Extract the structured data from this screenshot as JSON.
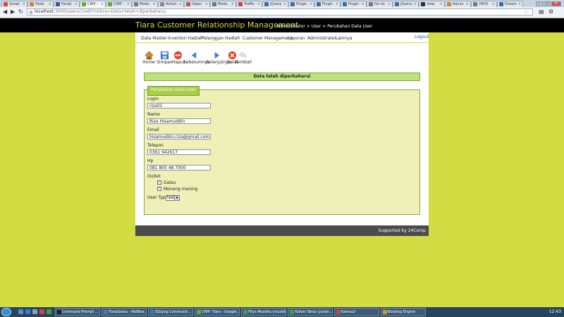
{
  "browser": {
    "tabs": [
      {
        "label": "Gmail",
        "color": "#d44"
      },
      {
        "label": "Howl",
        "color": "#c83"
      },
      {
        "label": "Faceb",
        "color": "#3b5998"
      },
      {
        "label": "CRM -",
        "color": "#6a3",
        "active": true
      },
      {
        "label": "CRM -",
        "color": "#6a3"
      },
      {
        "label": "Modu",
        "color": "#777"
      },
      {
        "label": "Action",
        "color": "#888"
      },
      {
        "label": "Oops!",
        "color": "#b55"
      },
      {
        "label": "Modu",
        "color": "#777"
      },
      {
        "label": "Traffic",
        "color": "#c44"
      },
      {
        "label": "jQuery",
        "color": "#3a6ea5"
      },
      {
        "label": "Plugin",
        "color": "#3a6ea5"
      },
      {
        "label": "Plugin",
        "color": "#3a6ea5"
      },
      {
        "label": "Plugin",
        "color": "#3a6ea5"
      },
      {
        "label": "Do no",
        "color": "#777"
      },
      {
        "label": "jQuery",
        "color": "#3a6ea5"
      },
      {
        "label": "view",
        "color": "#333"
      },
      {
        "label": "Advan",
        "color": "#c83"
      },
      {
        "label": "(403)",
        "color": "#777"
      },
      {
        "label": "Dream",
        "color": "#3a6ea5"
      }
    ],
    "url_host": "localhost",
    "url_rest": ":3000/users/1/edit?notice=Data+telah+diperbaharui"
  },
  "app": {
    "title": "Tiara Customer Relationship Management",
    "breadcrumb": "Administrator > User > Perubahan Data User",
    "menu": [
      "Data Master",
      "Inventori Hadiah",
      "Pelanggan",
      "Hadiah",
      "Customer Management",
      "Laporan",
      "Administrator",
      "Lainnya"
    ],
    "logout": "Logout"
  },
  "toolbar": {
    "home": "Home",
    "save": "Simpan",
    "delete": "Hapus",
    "prev": "Sebelumnya",
    "next": "Selanjutnya",
    "cancel": "Batal",
    "back": "Kembali"
  },
  "notice": "Data telah diperbaharui",
  "form": {
    "legend": "Perubahan Data User",
    "login_label": "Login",
    "login_value": "riza01",
    "name_label": "Name",
    "name_value": "Riza Hisamuddin",
    "email_label": "Email",
    "email_value": "hisamuddin.riza@gmail.com",
    "phone_label": "Telepon",
    "phone_value": "0361 942617",
    "hp_label": "Hp",
    "hp_value": "081 805 48 7000",
    "outlet_label": "Outlet",
    "outlets": [
      {
        "label": "Gatsu",
        "checked": true
      },
      {
        "label": "Monang maning",
        "checked": true
      }
    ],
    "usertype_label": "User Type",
    "usertype_value": "test"
  },
  "footer": "Supported by 24Comp",
  "taskbar": {
    "tasks": [
      {
        "label": "Command Prompt ...",
        "color": "#222"
      },
      {
        "label": "TiaraGatsu - NetBea...",
        "color": "#4a7ab5"
      },
      {
        "label": "SQLyog Communit...",
        "color": "#3a7ab0"
      },
      {
        "label": "CRM- Tiara - Google...",
        "color": "#6a3"
      },
      {
        "label": "Fitya Mustika (mustik...",
        "color": "#4a9a4a"
      },
      {
        "label": "Yuliani Tania (yulian...",
        "color": "#4a9a4a"
      },
      {
        "label": "Kamus2",
        "color": "#c44"
      },
      {
        "label": "Booking Engine",
        "color": "#c8a020"
      }
    ],
    "clock": "12:43"
  }
}
